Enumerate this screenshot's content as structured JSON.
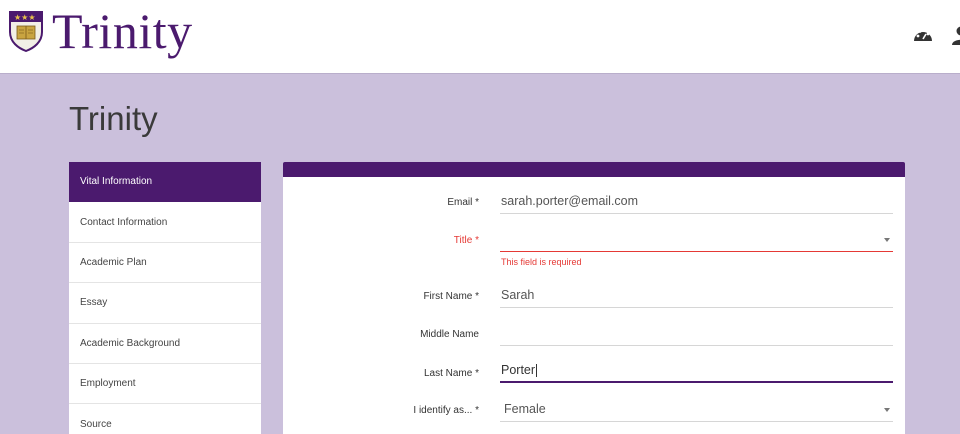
{
  "header": {
    "logo_text": "Trinity",
    "icons": [
      "dashboard-icon",
      "user-icon"
    ]
  },
  "page": {
    "title": "Trinity"
  },
  "sidebar": {
    "items": [
      {
        "label": "Vital Information",
        "active": true
      },
      {
        "label": "Contact Information"
      },
      {
        "label": "Academic Plan"
      },
      {
        "label": "Essay"
      },
      {
        "label": "Academic Background"
      },
      {
        "label": "Employment"
      },
      {
        "label": "Source"
      }
    ]
  },
  "form": {
    "email": {
      "label": "Email *",
      "value": "sarah.porter@email.com"
    },
    "title": {
      "label": "Title *",
      "value": "",
      "error": "This field is required"
    },
    "first_name": {
      "label": "First Name *",
      "value": "Sarah"
    },
    "middle_name": {
      "label": "Middle Name",
      "value": ""
    },
    "last_name": {
      "label": "Last Name *",
      "value": "Porter"
    },
    "identify": {
      "label": "I identify as... *",
      "value": "Female"
    }
  },
  "colors": {
    "brand": "#4b1a6e",
    "background": "#cbc0dc",
    "error": "#e53935"
  }
}
